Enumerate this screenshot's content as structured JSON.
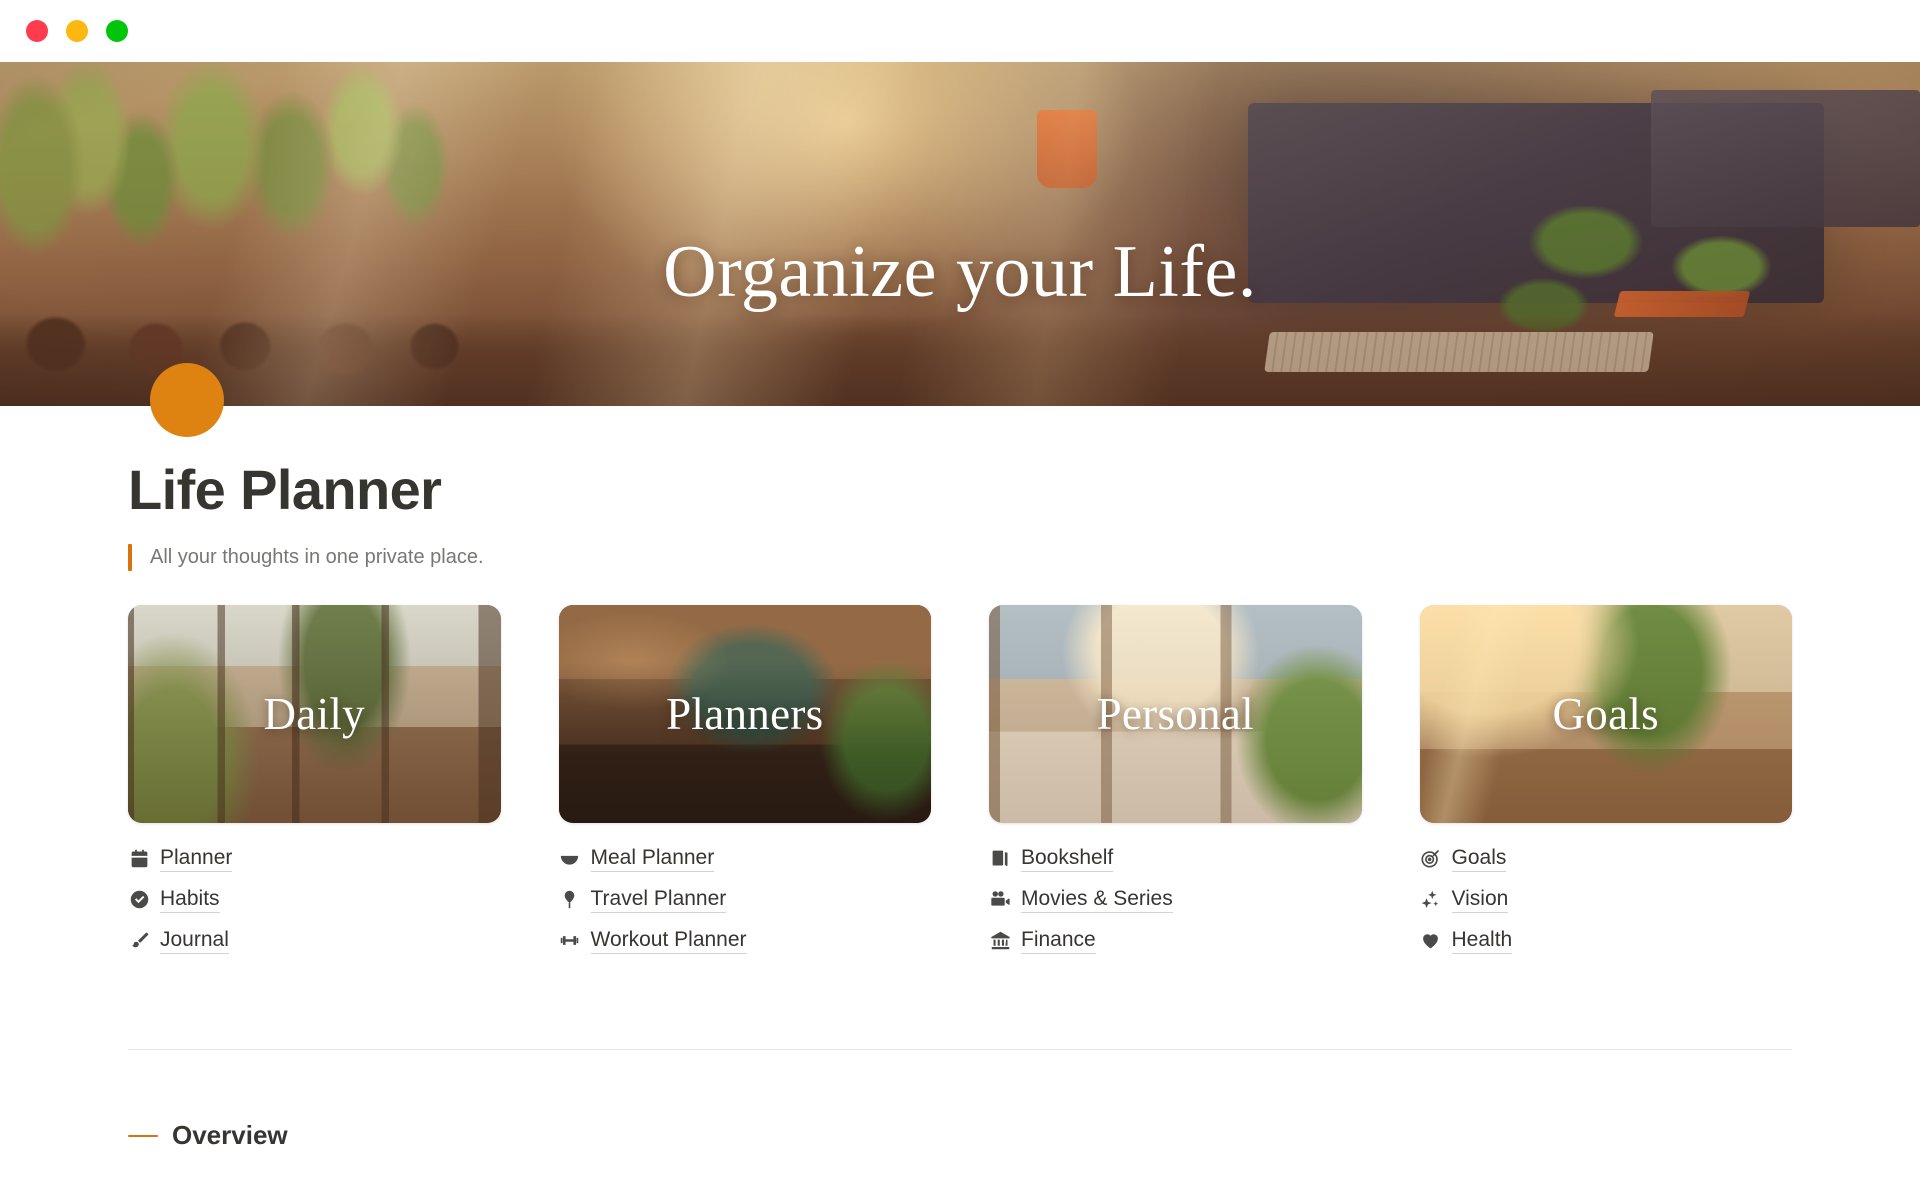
{
  "window": {
    "traffic_lights": [
      {
        "name": "close",
        "color": "#FF3B4E"
      },
      {
        "name": "minimize",
        "color": "#FCB711"
      },
      {
        "name": "maximize",
        "color": "#00C50B"
      }
    ]
  },
  "hero": {
    "title": "Organize your Life.",
    "image_description": "Sunlit home office window sill with potted plants, wooden desk, monitor and keyboard"
  },
  "page": {
    "icon": "orange-circle-icon",
    "icon_color": "#DE8211",
    "title": "Life Planner",
    "subtitle": "All your thoughts in one private place.",
    "accent_color": "#D9730D"
  },
  "cards": [
    {
      "title": "Daily",
      "image_description": "Loft apartment window with bookshelf, plants and city skyline",
      "links": [
        {
          "icon": "calendar-icon",
          "label": "Planner"
        },
        {
          "icon": "check-circle-icon",
          "label": "Habits"
        },
        {
          "icon": "paintbrush-icon",
          "label": "Journal"
        }
      ]
    },
    {
      "title": "Planners",
      "image_description": "Dim cozy workspace with desk, laptop, radio and plants",
      "links": [
        {
          "icon": "bowl-icon",
          "label": "Meal Planner"
        },
        {
          "icon": "map-pin-icon",
          "label": "Travel Planner"
        },
        {
          "icon": "dumbbell-icon",
          "label": "Workout Planner"
        }
      ]
    },
    {
      "title": "Personal",
      "image_description": "Sunlit bedroom with bed, shelves and city view window",
      "links": [
        {
          "icon": "book-icon",
          "label": "Bookshelf"
        },
        {
          "icon": "video-camera-icon",
          "label": "Movies & Series"
        },
        {
          "icon": "bank-icon",
          "label": "Finance"
        }
      ]
    },
    {
      "title": "Goals",
      "image_description": "Sunrise desk setup with monitor, keyboard, plants and skyline",
      "links": [
        {
          "icon": "target-icon",
          "label": "Goals"
        },
        {
          "icon": "sparkles-icon",
          "label": "Vision"
        },
        {
          "icon": "heart-icon",
          "label": "Health"
        }
      ]
    }
  ],
  "overview": {
    "dash": "—",
    "label": "Overview"
  }
}
